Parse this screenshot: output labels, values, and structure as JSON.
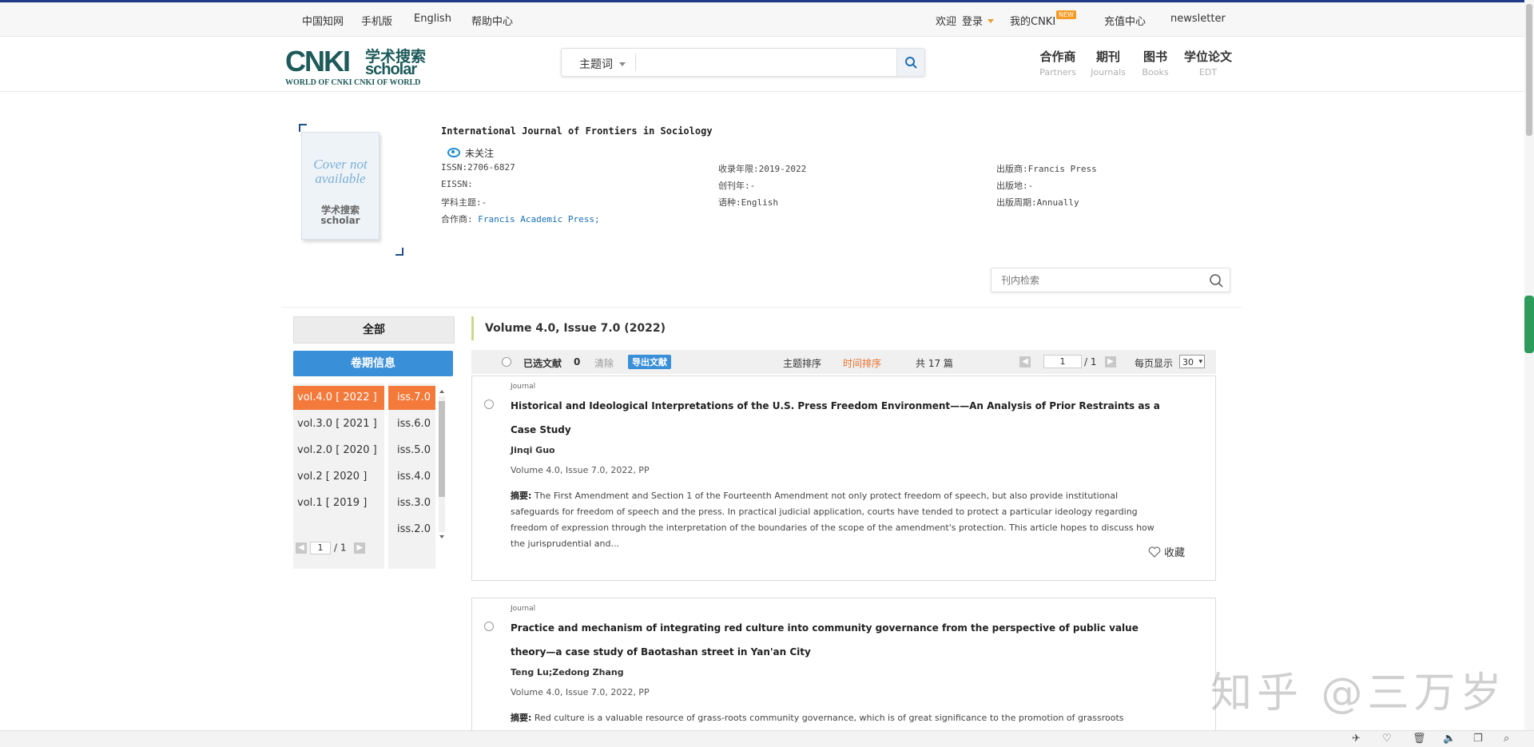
{
  "topnav": {
    "left": [
      "中国知网",
      "手机版",
      "English",
      "帮助中心"
    ],
    "welcome": "欢迎",
    "login": "登录",
    "my_cnki": "我的CNKI",
    "new_badge": "NEW",
    "recharge": "充值中心",
    "newsletter": "newsletter"
  },
  "header": {
    "logo": {
      "cnki": "CNKI",
      "xueshu": "学术搜索",
      "scholar": "scholar",
      "subtitle": "WORLD OF CNKI CNKI OF WORLD"
    },
    "search": {
      "field": "主题词",
      "value": ""
    },
    "nav": [
      {
        "zh": "合作商",
        "en": "Partners"
      },
      {
        "zh": "期刊",
        "en": "Journals"
      },
      {
        "zh": "图书",
        "en": "Books"
      },
      {
        "zh": "学位论文",
        "en": "EDT"
      }
    ]
  },
  "journal": {
    "cover_text": "Cover not available",
    "cover_logo": "学术搜索 scholar",
    "title": "International Journal of Frontiers in Sociology",
    "follow": "未关注",
    "issn": "ISSN:2706-6827",
    "eissn": "EISSN:",
    "subject": "学科主题:-",
    "partner_label": "合作商:",
    "partner": "Francis Academic Press;",
    "years": "收录年限:2019-2022",
    "founded": "创刊年:-",
    "language": "语种:English",
    "publisher": "出版商:Francis Press",
    "place": "出版地:-",
    "cycle": "出版周期:Annually",
    "inner_search_placeholder": "刊内检索"
  },
  "sidebar": {
    "all": "全部",
    "vol_info": "卷期信息",
    "volumes": [
      "vol.4.0 [ 2022 ]",
      "vol.3.0 [ 2021 ]",
      "vol.2.0 [ 2020 ]",
      "vol.2 [ 2020 ]",
      "vol.1 [ 2019 ]"
    ],
    "issues": [
      "iss.7.0",
      "iss.6.0",
      "iss.5.0",
      "iss.4.0",
      "iss.3.0",
      "iss.2.0"
    ],
    "pager": {
      "page": "1",
      "total": "/ 1"
    }
  },
  "main": {
    "volume_title": "Volume 4.0, Issue 7.0 (2022)",
    "toolbar": {
      "selected_label": "已选文献",
      "selected_count": "0",
      "clear": "清除",
      "export": "导出文献",
      "sort_subject": "主题排序",
      "sort_time": "时间排序",
      "total": "共 17 篇",
      "page": "1",
      "page_total": "/ 1",
      "per_page_label": "每页显示",
      "per_page": "30"
    },
    "articles": [
      {
        "type": "Journal",
        "title": "Historical and Ideological Interpretations of the U.S. Press Freedom Environment——An Analysis of Prior Restraints as a Case Study",
        "authors": "Jinqi Guo",
        "vinfo": "Volume 4.0, Issue 7.0, 2022, PP",
        "abstract_label": "摘要:",
        "abstract": "The First Amendment and Section 1 of the Fourteenth Amendment not only protect freedom of speech, but also provide institutional safeguards for freedom of speech and the press. In practical judicial application, courts have tended to protect a particular ideology regarding freedom of expression through the interpretation of the boundaries of the scope of the amendment's protection. This article hopes to discuss how the jurisprudential and...",
        "favorite": "收藏"
      },
      {
        "type": "Journal",
        "title": "Practice and mechanism of integrating red culture into community governance from the perspective of public value theory—a case study of Baotashan street in Yan'an City",
        "authors": "Teng Lu;Zedong Zhang",
        "vinfo": "Volume 4.0, Issue 7.0, 2022, PP",
        "abstract_label": "摘要:",
        "abstract": "Red culture is a valuable resource of grass-roots community governance, which is of great significance to the promotion of grassroots governance"
      }
    ]
  },
  "watermark": "知乎 @三万岁",
  "colors": {
    "accent_blue": "#3a8fd9",
    "active_orange": "#f47a3c",
    "brand_teal": "#1e5a5a"
  }
}
